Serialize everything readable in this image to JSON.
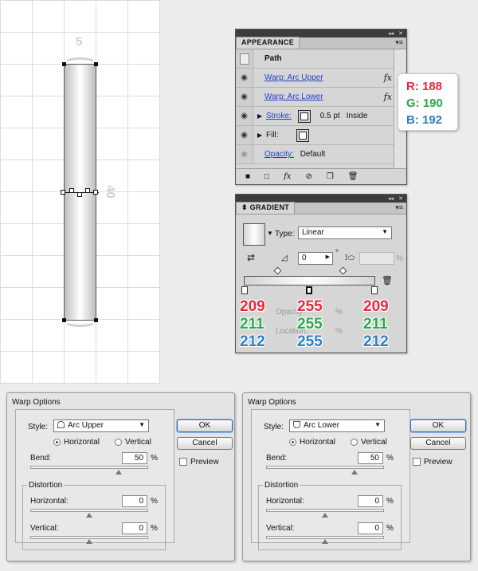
{
  "artboard": {
    "width_label": "5",
    "height_label": "40"
  },
  "appearance": {
    "tab": "APPEARANCE",
    "path_label": "Path",
    "warp_upper": "Warp: Arc Upper",
    "warp_lower": "Warp: Arc Lower",
    "fx": "fx",
    "stroke_label": "Stroke:",
    "stroke_weight": "0.5 pt",
    "stroke_align": "Inside",
    "fill_label": "Fill:",
    "opacity_label": "Opacity:",
    "opacity_value": "Default"
  },
  "callout": {
    "r": "R: 188",
    "g": "G: 190",
    "b": "B: 192",
    "r_color": "#e8283c",
    "g_color": "#2aa84a",
    "b_color": "#2f7ec2"
  },
  "gradient": {
    "tab": "GRADIENT",
    "type_label": "Type:",
    "type_value": "Linear",
    "angle_value": "0",
    "degree": "°",
    "percent": "%",
    "opacity_faint": "Opacity:",
    "location_faint": "Location:",
    "stop_left": {
      "r": "209",
      "g": "211",
      "b": "212"
    },
    "stop_mid": {
      "r": "255",
      "g": "255",
      "b": "255"
    },
    "stop_right": {
      "r": "209",
      "g": "211",
      "b": "212"
    }
  },
  "warp_dialogs": [
    {
      "title": "Warp Options",
      "style_label": "Style:",
      "style_value": "Arc Upper",
      "horizontal": "Horizontal",
      "vertical": "Vertical",
      "bend_label": "Bend:",
      "bend_value": "50",
      "percent": "%",
      "distortion_label": "Distortion",
      "dist_h_label": "Horizontal:",
      "dist_h_value": "0",
      "dist_v_label": "Vertical:",
      "dist_v_value": "0",
      "ok": "OK",
      "cancel": "Cancel",
      "preview": "Preview"
    },
    {
      "title": "Warp Options",
      "style_label": "Style:",
      "style_value": "Arc Lower",
      "horizontal": "Horizontal",
      "vertical": "Vertical",
      "bend_label": "Bend:",
      "bend_value": "50",
      "percent": "%",
      "distortion_label": "Distortion",
      "dist_h_label": "Horizontal:",
      "dist_h_value": "0",
      "dist_v_label": "Vertical:",
      "dist_v_value": "0",
      "ok": "OK",
      "cancel": "Cancel",
      "preview": "Preview"
    }
  ]
}
